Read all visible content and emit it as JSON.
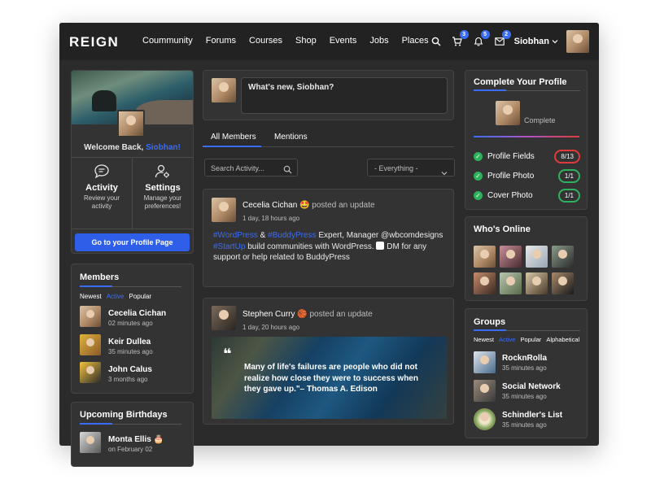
{
  "header": {
    "logo": "REIGN",
    "nav": [
      "Coummunity",
      "Forums",
      "Courses",
      "Shop",
      "Events",
      "Jobs",
      "Places"
    ],
    "cart_badge": "3",
    "notif_badge": "5",
    "msg_badge": "2",
    "username": "Siobhan"
  },
  "welcome": {
    "prefix": "Welcome Back, ",
    "name": "Siobhan!",
    "activity_title": "Activity",
    "activity_desc": "Review your activity",
    "settings_title": "Settings",
    "settings_desc": "Manage your preferences!",
    "profile_button": "Go to your Profile Page"
  },
  "members": {
    "title": "Members",
    "tabs": [
      "Newest",
      "Active",
      "Popular"
    ],
    "list": [
      {
        "name": "Cecelia Cichan",
        "time": "02 minutes ago"
      },
      {
        "name": "Keir Dullea",
        "time": "35 minutes ago"
      },
      {
        "name": "John Calus",
        "time": "3 months ago"
      }
    ]
  },
  "birthdays": {
    "title": "Upcoming Birthdays",
    "name": "Monta Ellis",
    "date": "on February 02"
  },
  "composer": {
    "placeholder": "What's new, Siobhan?"
  },
  "feed_tabs": [
    "All Members",
    "Mentions"
  ],
  "search": {
    "placeholder": "Search Activity...",
    "filter": "- Everything -"
  },
  "posts": [
    {
      "author": "Cecelia Cichan",
      "action": "posted an update",
      "time": "1 day, 18 hours ago",
      "tag1": "#WordPress",
      "amp": " & ",
      "tag2": "#BuddyPress",
      "text1": " Expert, Manager @wbcomdesigns",
      "tag3": "#StartUp",
      "text2": " build communities with WordPress.",
      "text3": " DM for any support or help related to BuddyPress"
    },
    {
      "author": "Stephen Curry",
      "action": "posted an update",
      "time": "1 day, 20 hours ago",
      "quote": "Many of life's failures are people who did not realize how close they were to success when they gave up.\"– Thomas A. Edison"
    }
  ],
  "profile_complete": {
    "title": "Complete Your Profile",
    "status": "Complete",
    "items": [
      {
        "label": "Profile Fields",
        "value": "8/13",
        "color": "#e03a3a"
      },
      {
        "label": "Profile Photo",
        "value": "1/1",
        "color": "#2eb15c"
      },
      {
        "label": "Cover Photo",
        "value": "1/1",
        "color": "#2eb15c"
      }
    ]
  },
  "online": {
    "title": "Who's Online"
  },
  "groups": {
    "title": "Groups",
    "tabs": [
      "Newest",
      "Active",
      "Popular",
      "Alphabetical"
    ],
    "list": [
      {
        "name": "RocknRolla",
        "time": "35 minutes ago"
      },
      {
        "name": "Social Network",
        "time": "35 minutes ago"
      },
      {
        "name": "Schindler's List",
        "time": "35 minutes ago"
      }
    ]
  },
  "colors": {
    "accent": "#3b6cf5",
    "background": "#2b2b2b",
    "panel": "#333333",
    "success": "#2eb15c",
    "danger": "#e03a3a"
  }
}
